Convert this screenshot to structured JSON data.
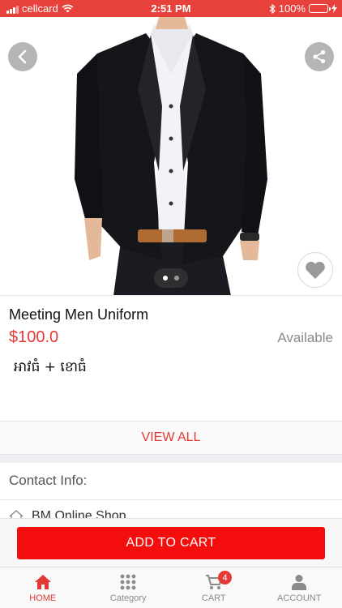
{
  "status_bar": {
    "carrier": "cellcard",
    "time": "2:51 PM",
    "battery_percent": "100%",
    "battery_level": 1.0,
    "icons": [
      "signal-icon",
      "wifi-icon",
      "bluetooth-icon",
      "battery-icon",
      "charging-icon"
    ]
  },
  "gallery": {
    "image_subject": "man in black blazer and white shirt",
    "page_count": 2,
    "current_page": 1,
    "back_icon": "chevron-left-icon",
    "share_icon": "share-icon",
    "favorite_icon": "heart-icon"
  },
  "product": {
    "name": "Meeting Men Uniform",
    "price": "$100.0",
    "availability": "Available",
    "description": "អាវធំ + ខោធំ"
  },
  "view_all_label": "VIEW ALL",
  "contact": {
    "title": "Contact Info:",
    "shop_name": "BM Online Shop",
    "shop_icon": "home-icon"
  },
  "add_to_cart_label": "ADD TO CART",
  "tabs": [
    {
      "label": "HOME",
      "icon": "home-icon",
      "active": true
    },
    {
      "label": "Category",
      "icon": "grid-icon",
      "active": false
    },
    {
      "label": "CART",
      "icon": "cart-icon",
      "active": false,
      "badge": "4"
    },
    {
      "label": "ACCOUNT",
      "icon": "user-icon",
      "active": false
    }
  ],
  "colors": {
    "brand_red": "#e8403a",
    "price_red": "#e53935",
    "button_red": "#f40d0d",
    "muted_gray": "#8a8a8a"
  }
}
